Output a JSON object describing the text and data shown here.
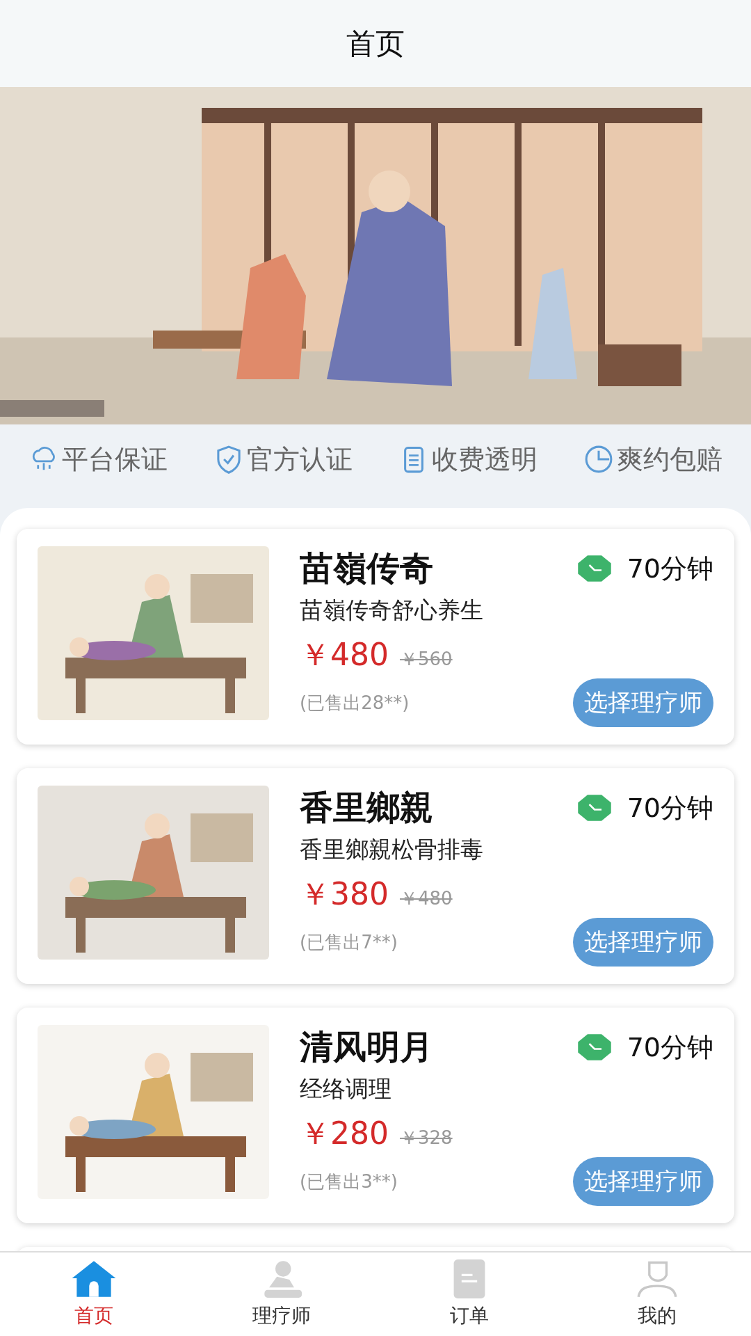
{
  "header": {
    "title": "首页"
  },
  "guarantees": [
    {
      "label": "平台保证",
      "kind": "cloud"
    },
    {
      "label": "官方认证",
      "kind": "shield"
    },
    {
      "label": "收费透明",
      "kind": "clipboard"
    },
    {
      "label": "爽约包赔",
      "kind": "clock"
    }
  ],
  "services": [
    {
      "name": "苗嶺传奇",
      "subtitle": "苗嶺传奇舒心养生",
      "duration": "70分钟",
      "price": "￥480",
      "original_price": "￥560",
      "sold": "(已售出28**)",
      "button": "选择理疗师"
    },
    {
      "name": "香里鄉親",
      "subtitle": "香里鄉親松骨排毒",
      "duration": "70分钟",
      "price": "￥380",
      "original_price": "￥480",
      "sold": "(已售出7**)",
      "button": "选择理疗师"
    },
    {
      "name": "清风明月",
      "subtitle": "经络调理",
      "duration": "70分钟",
      "price": "￥280",
      "original_price": "￥328",
      "sold": "(已售出3**)",
      "button": "选择理疗师"
    }
  ],
  "tabs": [
    {
      "label": "首页",
      "kind": "home",
      "selected": true
    },
    {
      "label": "理疗师",
      "kind": "therapist",
      "selected": false
    },
    {
      "label": "订单",
      "kind": "order",
      "selected": false
    },
    {
      "label": "我的",
      "kind": "profile",
      "selected": false
    }
  ]
}
